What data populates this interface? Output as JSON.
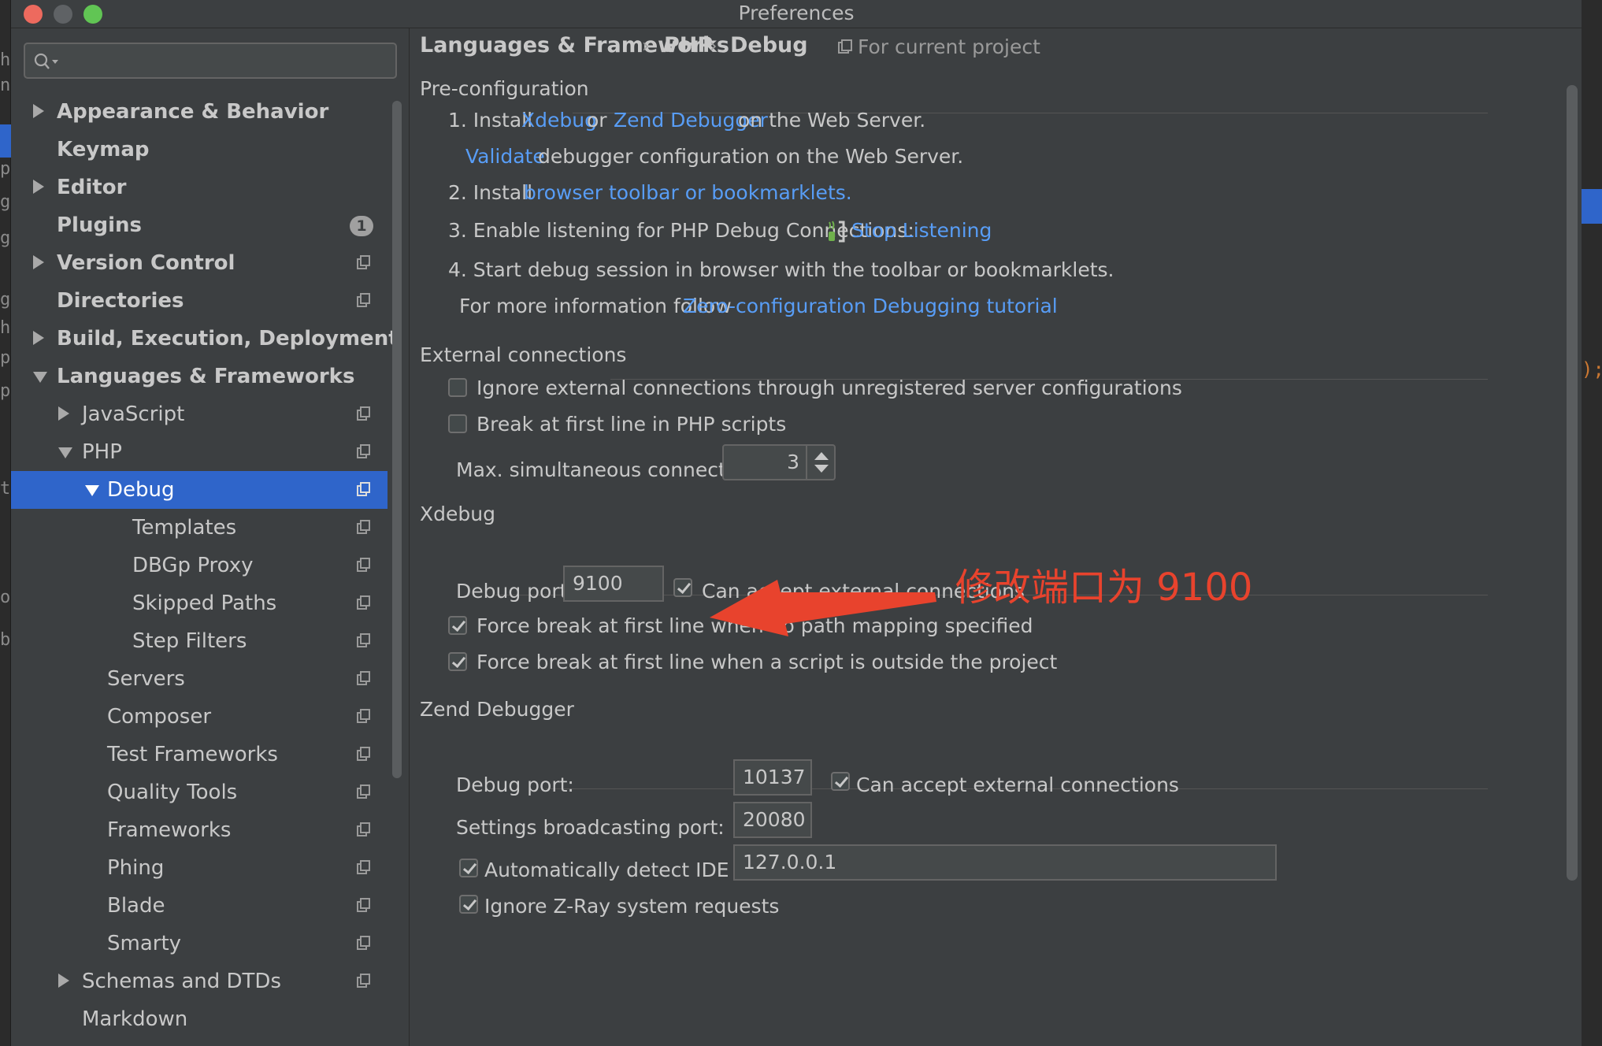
{
  "window": {
    "title": "Preferences"
  },
  "background": {
    "left_edge": [
      "h",
      "n",
      "p",
      "g.",
      "g",
      "g",
      "h",
      "pl",
      "p",
      "tr",
      "or",
      "b"
    ],
    "right_edge_code": ");"
  },
  "sidebar": {
    "search_placeholder": "",
    "items": [
      {
        "label": "Appearance & Behavior",
        "level": 0,
        "arrow": "right",
        "bold": true
      },
      {
        "label": "Keymap",
        "level": 0,
        "arrow": "",
        "bold": true
      },
      {
        "label": "Editor",
        "level": 0,
        "arrow": "right",
        "bold": true
      },
      {
        "label": "Plugins",
        "level": 0,
        "arrow": "",
        "bold": true,
        "badge": "1"
      },
      {
        "label": "Version Control",
        "level": 0,
        "arrow": "right",
        "bold": true,
        "project": true
      },
      {
        "label": "Directories",
        "level": 0,
        "arrow": "",
        "bold": true,
        "project": true
      },
      {
        "label": "Build, Execution, Deployment",
        "level": 0,
        "arrow": "right",
        "bold": true
      },
      {
        "label": "Languages & Frameworks",
        "level": 0,
        "arrow": "down",
        "bold": true
      },
      {
        "label": "JavaScript",
        "level": 1,
        "arrow": "right",
        "project": true
      },
      {
        "label": "PHP",
        "level": 1,
        "arrow": "down",
        "project": true
      },
      {
        "label": "Debug",
        "level": 2,
        "arrow": "down",
        "project": true,
        "selected": true
      },
      {
        "label": "Templates",
        "level": 3,
        "arrow": "",
        "project": true
      },
      {
        "label": "DBGp Proxy",
        "level": 3,
        "arrow": "",
        "project": true
      },
      {
        "label": "Skipped Paths",
        "level": 3,
        "arrow": "",
        "project": true
      },
      {
        "label": "Step Filters",
        "level": 3,
        "arrow": "",
        "project": true
      },
      {
        "label": "Servers",
        "level": 2,
        "arrow": "",
        "project": true
      },
      {
        "label": "Composer",
        "level": 2,
        "arrow": "",
        "project": true
      },
      {
        "label": "Test Frameworks",
        "level": 2,
        "arrow": "",
        "project": true
      },
      {
        "label": "Quality Tools",
        "level": 2,
        "arrow": "",
        "project": true
      },
      {
        "label": "Frameworks",
        "level": 2,
        "arrow": "",
        "project": true
      },
      {
        "label": "Phing",
        "level": 2,
        "arrow": "",
        "project": true
      },
      {
        "label": "Blade",
        "level": 2,
        "arrow": "",
        "project": true
      },
      {
        "label": "Smarty",
        "level": 2,
        "arrow": "",
        "project": true
      },
      {
        "label": "Schemas and DTDs",
        "level": 1,
        "arrow": "right",
        "project": true
      },
      {
        "label": "Markdown",
        "level": 1,
        "arrow": ""
      }
    ]
  },
  "breadcrumb": {
    "items": [
      "Languages & Frameworks",
      "PHP",
      "Debug"
    ],
    "separator": "›",
    "scope": "For current project"
  },
  "preconfig": {
    "title": "Pre-configuration",
    "step1": {
      "prefix": "1. Install",
      "link1": "Xdebug",
      "or": "or",
      "link2": "Zend Debugger",
      "suffix": "on the Web Server."
    },
    "step1b": {
      "link": "Validate",
      "suffix": "debugger configuration on the Web Server."
    },
    "step2": {
      "prefix": "2. Install",
      "link": "browser toolbar or bookmarklets."
    },
    "step3": {
      "prefix": "3. Enable listening for PHP Debug Connections:",
      "link": "Stop Listening"
    },
    "step4": {
      "text": "4. Start debug session in browser with the toolbar or bookmarklets."
    },
    "more": {
      "prefix": "For more information follow",
      "link": "Zero-configuration Debugging tutorial"
    }
  },
  "external": {
    "title": "External connections",
    "ignore_label": "Ignore external connections through unregistered server configurations",
    "ignore_checked": false,
    "break_label": "Break at first line in PHP scripts",
    "break_checked": false,
    "max_label": "Max. simultaneous connections:",
    "max_value": "3"
  },
  "xdebug": {
    "title": "Xdebug",
    "port_label": "Debug port:",
    "port_value": "9100",
    "accept_label": "Can accept external connections",
    "accept_checked": true,
    "force_nomap_label": "Force break at first line when no path mapping specified",
    "force_nomap_checked": true,
    "force_outside_label": "Force break at first line when a script is outside the project",
    "force_outside_checked": true
  },
  "zend": {
    "title": "Zend Debugger",
    "port_label": "Debug port:",
    "port_value": "10137",
    "accept_label": "Can accept external connections",
    "accept_checked": true,
    "broadcast_label": "Settings broadcasting port:",
    "broadcast_value": "20080",
    "detect_label": "Automatically detect IDE IP:",
    "detect_checked": true,
    "ip_value": "127.0.0.1",
    "zray_label": "Ignore Z-Ray system requests",
    "zray_checked": true
  },
  "annotation": {
    "text": "修改端口为 9100",
    "color": "#e8432d"
  },
  "colors": {
    "accent": "#2f65ca",
    "link": "#589df6",
    "panel": "#3c3f41"
  }
}
